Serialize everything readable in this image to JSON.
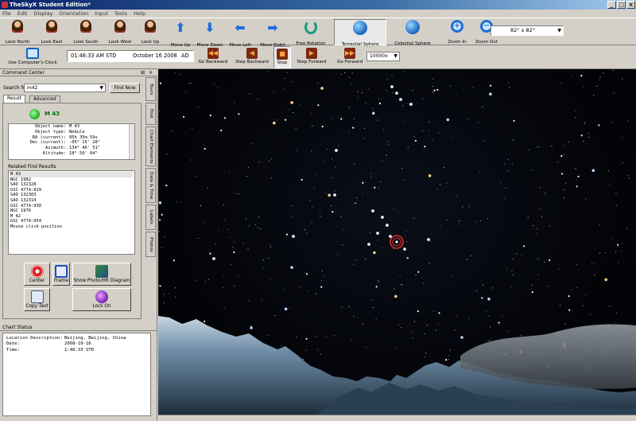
{
  "window": {
    "title": "TheSkyX Student Edition*"
  },
  "menu": [
    "File",
    "Edit",
    "Display",
    "Orientation",
    "Input",
    "Tools",
    "Help"
  ],
  "toolbar1": [
    {
      "label": "Look North",
      "icon": "person-north-icon",
      "kind": "person",
      "active": false
    },
    {
      "label": "Look East",
      "icon": "person-east-icon",
      "kind": "person",
      "active": false
    },
    {
      "label": "Look South",
      "icon": "person-south-icon",
      "kind": "person",
      "active": false
    },
    {
      "label": "Look West",
      "icon": "person-west-icon",
      "kind": "person",
      "active": false
    },
    {
      "label": "Look Up",
      "icon": "person-up-icon",
      "kind": "person",
      "active": false
    },
    {
      "label": "Move Up",
      "icon": "arrow-up-icon",
      "kind": "arrow",
      "glyph": "⬆",
      "active": false
    },
    {
      "label": "Move Down",
      "icon": "arrow-down-icon",
      "kind": "arrow",
      "glyph": "⬇",
      "active": false
    },
    {
      "label": "Move Left",
      "icon": "arrow-left-icon",
      "kind": "arrow",
      "glyph": "⬅",
      "active": false
    },
    {
      "label": "Move Right",
      "icon": "arrow-right-icon",
      "kind": "arrow",
      "glyph": "➡",
      "active": false
    },
    {
      "label": "Free Rotation",
      "icon": "rotation-icon",
      "kind": "rot",
      "active": false
    },
    {
      "label": "Terrestial Sphere",
      "icon": "terrestial-sphere-icon",
      "kind": "sphere",
      "active": true
    },
    {
      "label": "Celestial Sphere",
      "icon": "celestial-sphere-icon",
      "kind": "sphere",
      "active": false
    },
    {
      "label": "Zoom In",
      "icon": "zoom-in-icon",
      "kind": "zoom",
      "glyph": "+",
      "active": false
    },
    {
      "label": "Zoom Out",
      "icon": "zoom-out-icon",
      "kind": "zoom",
      "glyph": "−",
      "active": false
    }
  ],
  "fov": {
    "value": "82° x 82°"
  },
  "toolbar2": {
    "use_clock_label": "Use Computer's Clock",
    "time": "01:46:33 AM STD",
    "date": "October 16 2008",
    "era": "AD",
    "buttons": [
      {
        "label": "Go Backward",
        "icon": "go-backward-icon",
        "glyph": "◀◀"
      },
      {
        "label": "Step Backward",
        "icon": "step-backward-icon",
        "glyph": "◀"
      },
      {
        "label": "Stop",
        "icon": "stop-icon",
        "glyph": "■"
      },
      {
        "label": "Step Forward",
        "icon": "step-forward-icon",
        "glyph": "▶"
      },
      {
        "label": "Go Forward",
        "icon": "go-forward-icon",
        "glyph": "▶▶"
      }
    ],
    "rate": "10000x"
  },
  "command_center": {
    "title": "Command Center",
    "search_label": "Search for:",
    "search_value": "m42",
    "find_now": "Find Now",
    "tabs": [
      "Result",
      "Advanced"
    ],
    "object": "M 43",
    "info": [
      {
        "k": "Object name:",
        "v": "M 43"
      },
      {
        "k": "Object type:",
        "v": "Nebula"
      },
      {
        "k": "RA (current):",
        "v": "05h 35m 59s"
      },
      {
        "k": "Dec (current):",
        "v": "-05° 15' 28\""
      },
      {
        "k": "Azimuth:",
        "v": "134° 46' 51\""
      },
      {
        "k": "Altitude:",
        "v": "18° 59' 04\""
      }
    ],
    "related_title": "Related Find Results",
    "related": [
      "M 43",
      "NGC 1982",
      "SAO 132328",
      "GSC 4774:829",
      "SAO 132303",
      "SAO 132314",
      "GSC 4774:930",
      "NGC 1976",
      "M 42",
      "GSC 4774:954",
      "Mouse click position"
    ],
    "buttons": {
      "center": "Center",
      "frame": "Frame",
      "photo": "Show Photo/HR Diagram",
      "copy": "Copy Text",
      "lock": "Lock On"
    }
  },
  "side_tabs": [
    "Tours",
    "Find",
    "Chart Elements",
    "Date & Time",
    "Labels",
    "Photos"
  ],
  "chart_status": {
    "title": "Chart Status",
    "rows": [
      {
        "k": "Location Description:",
        "v": "Beijing, Beijing, China"
      },
      {
        "k": "Date:",
        "v": "2008-10-16"
      },
      {
        "k": "Time:",
        "v": "1:46:33 STD"
      }
    ]
  },
  "colors": {
    "title_start": "#0a246a",
    "title_end": "#a6caf0",
    "chrome": "#d4d0c8",
    "sky": "#05070d",
    "target": "#d83030",
    "mountain": "#6f8ea8"
  }
}
